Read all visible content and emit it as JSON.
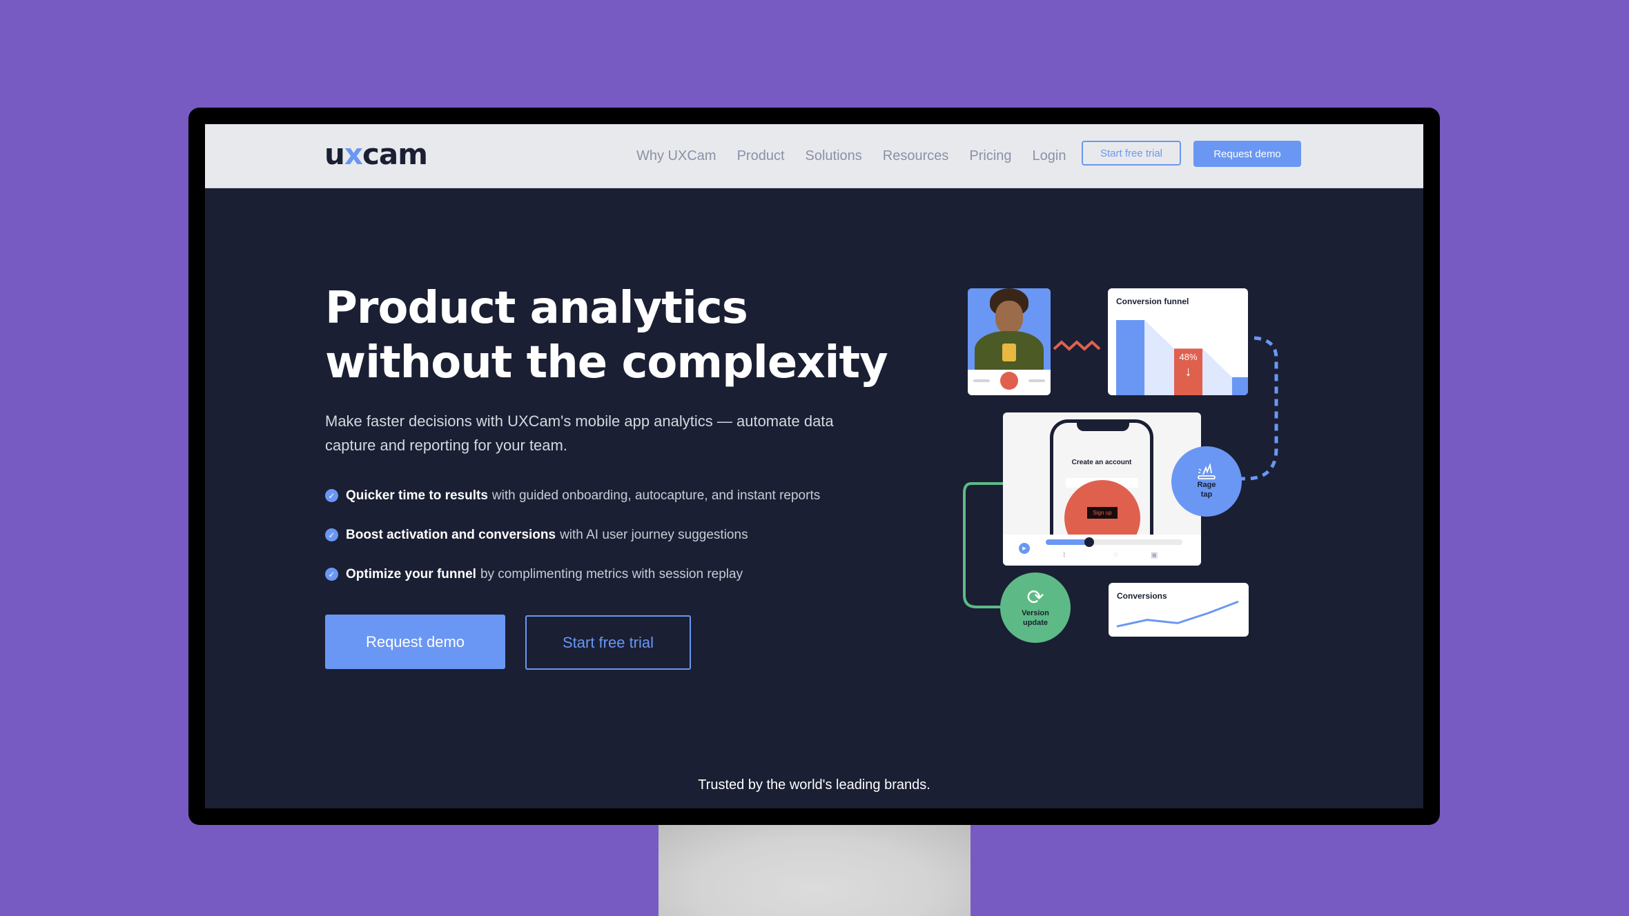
{
  "nav": {
    "logo": {
      "prefix": "u",
      "x": "x",
      "suffix": "cam"
    },
    "links": [
      "Why UXCam",
      "Product",
      "Solutions",
      "Resources",
      "Pricing",
      "Login"
    ],
    "start_trial": "Start free trial",
    "request_demo": "Request demo"
  },
  "hero": {
    "headline_line1": "Product analytics",
    "headline_line2": "without the complexity",
    "subtitle": "Make faster decisions with UXCam's mobile app analytics — automate data capture and reporting for your team.",
    "features": [
      {
        "bold": "Quicker time to results",
        "rest": "with guided onboarding, autocapture, and instant reports"
      },
      {
        "bold": "Boost activation and conversions",
        "rest": "with AI user journey suggestions"
      },
      {
        "bold": "Optimize your funnel",
        "rest": "by complimenting metrics with session replay"
      }
    ],
    "cta_primary": "Request demo",
    "cta_secondary": "Start free trial",
    "check_icon": "✓"
  },
  "illustration": {
    "funnel_title": "Conversion funnel",
    "funnel_drop": "48%",
    "funnel_arrow": "↓",
    "funnel_values": [
      1.0,
      0.62,
      0.24
    ],
    "phone_title": "Create an account",
    "phone_button": "Sign up",
    "replay_progress": 0.32,
    "rage_tap_line1": "Rage",
    "rage_tap_line2": "tap",
    "version_line1": "Version",
    "version_line2": "update",
    "conversions_title": "Conversions",
    "conversions_series": [
      0.1,
      0.3,
      0.2,
      0.5,
      0.85
    ]
  },
  "footer": {
    "trusted": "Trusted by the world's leading brands."
  },
  "colors": {
    "accent": "#6a97f3",
    "background": "#775bc3",
    "hero": "#1a1f33",
    "nav": "#e8e9ec",
    "red": "#e0604e",
    "green": "#5dba86"
  }
}
